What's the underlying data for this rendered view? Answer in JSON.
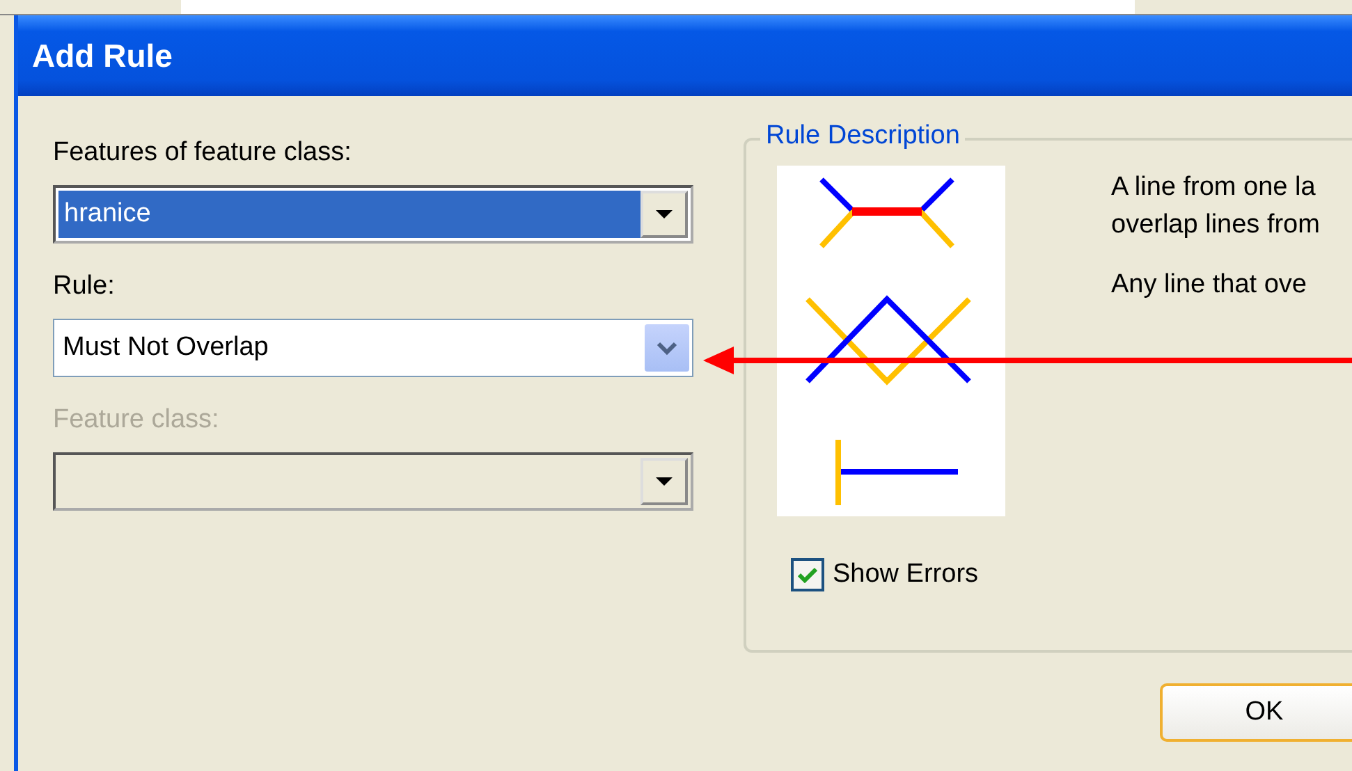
{
  "window": {
    "title": "Add Rule"
  },
  "fields": [
    {
      "kind": "classic",
      "label": "Features of feature class:",
      "value": "hranice",
      "disabled": false,
      "highlighted": true
    },
    {
      "kind": "themed",
      "label": "Rule:",
      "value": "Must Not Overlap",
      "disabled": false
    },
    {
      "kind": "classic",
      "label": "Feature class:",
      "disabled": true
    }
  ],
  "rule_description": {
    "title": "Rule Description",
    "paragraphs": [
      [
        "A line from one la",
        "overlap lines from"
      ],
      [
        "Any line that ove"
      ]
    ],
    "show_errors": {
      "label": "Show Errors",
      "checked": true
    }
  },
  "buttons": [
    "OK"
  ],
  "annotation": {
    "kind": "arrow",
    "color": "#ff0000"
  }
}
